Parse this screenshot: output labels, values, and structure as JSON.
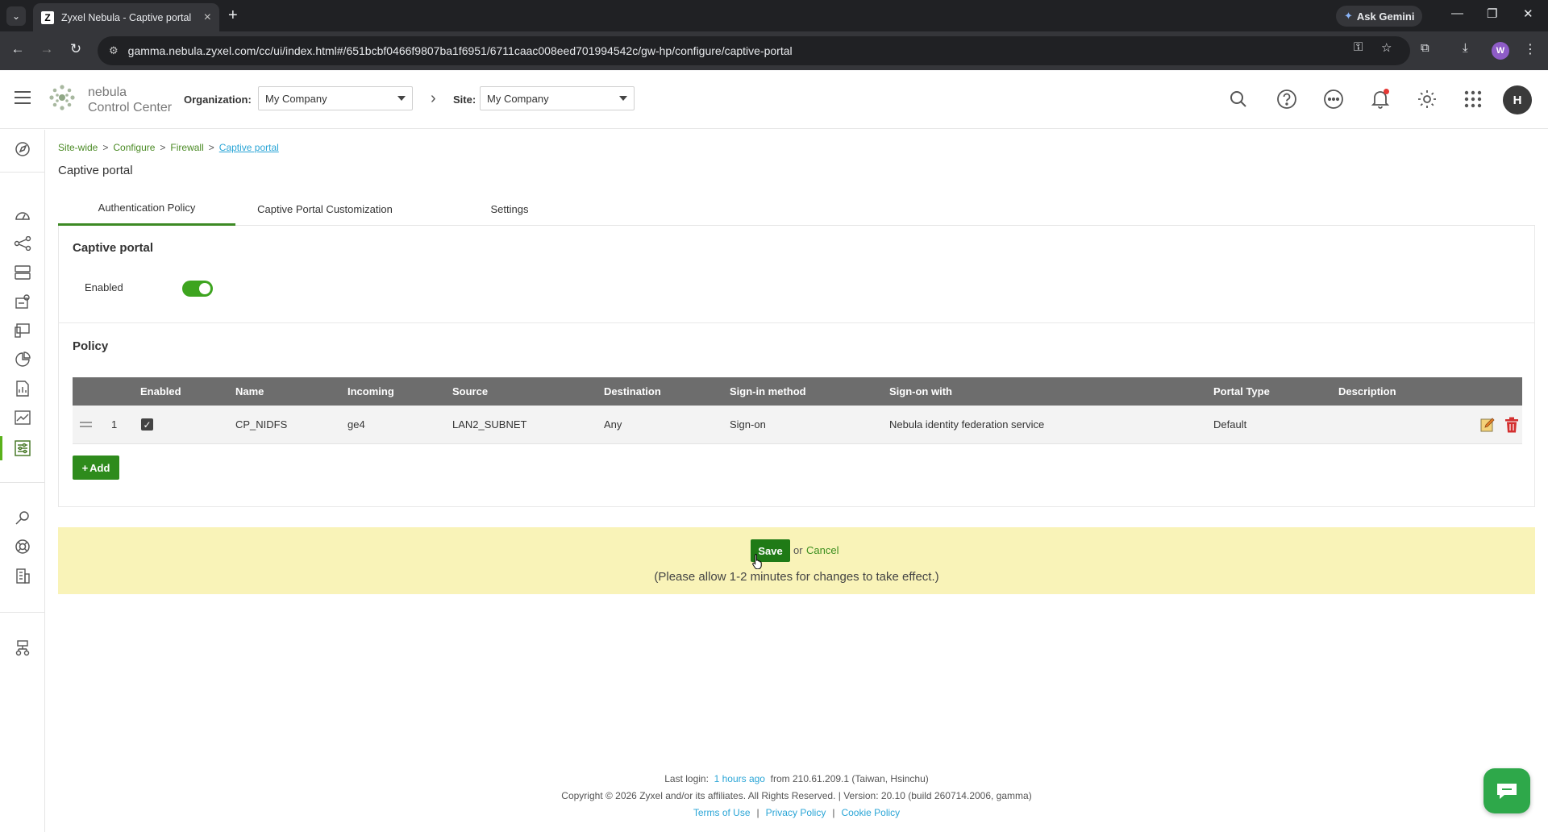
{
  "browser": {
    "tab_title": "Zyxel Nebula - Captive portal",
    "tab_favicon": "Z",
    "url": "gamma.nebula.zyxel.com/cc/ui/index.html#/651bcbf0466f9807ba1f6951/6711caac008eed701994542c/gw-hp/configure/captive-portal",
    "gemini_label": "Ask Gemini",
    "profile_initial": "W"
  },
  "header": {
    "logo_line1": "nebula",
    "logo_line2": "Control Center",
    "org_label": "Organization:",
    "org_value": "My Company",
    "site_label": "Site:",
    "site_value": "My Company",
    "avatar_initial": "H"
  },
  "breadcrumb": {
    "items": [
      "Site-wide",
      "Configure",
      "Firewall"
    ],
    "current": "Captive portal",
    "separator": ">"
  },
  "page": {
    "title": "Captive portal",
    "tabs": [
      "Authentication Policy",
      "Captive Portal Customization",
      "Settings"
    ],
    "active_tab": 0
  },
  "captive_portal": {
    "section_title": "Captive portal",
    "enabled_label": "Enabled",
    "enabled": true
  },
  "policy": {
    "section_title": "Policy",
    "columns": [
      "Enabled",
      "Name",
      "Incoming",
      "Source",
      "Destination",
      "Sign-in method",
      "Sign-on with",
      "Portal Type",
      "Description"
    ],
    "rows": [
      {
        "index": "1",
        "enabled": true,
        "name": "CP_NIDFS",
        "incoming": "ge4",
        "source": "LAN2_SUBNET",
        "destination": "Any",
        "signin_method": "Sign-on",
        "signon_with": "Nebula identity federation service",
        "portal_type": "Default",
        "description": ""
      }
    ],
    "add_label": "Add"
  },
  "savebar": {
    "save_label": "Save",
    "or_text": "or",
    "cancel_label": "Cancel",
    "note": "(Please allow 1-2 minutes for changes to take effect.)"
  },
  "footer": {
    "last_login_prefix": "Last login:",
    "last_login_ago": "1 hours ago",
    "last_login_from": "from 210.61.209.1 (Taiwan, Hsinchu)",
    "copyright": "Copyright © 2026 Zyxel and/or its affiliates. All Rights Reserved. | Version: 20.10 (build 260714.2006, gamma)",
    "links": [
      "Terms of Use",
      "Privacy Policy",
      "Cookie Policy"
    ]
  },
  "colors": {
    "brand_green": "#3da41f",
    "save_green": "#1f7a16",
    "link_blue": "#2aa5d6",
    "savebar_yellow": "#f9f3b8",
    "table_header": "#6d6d6d",
    "delete_red": "#d32f2f"
  }
}
